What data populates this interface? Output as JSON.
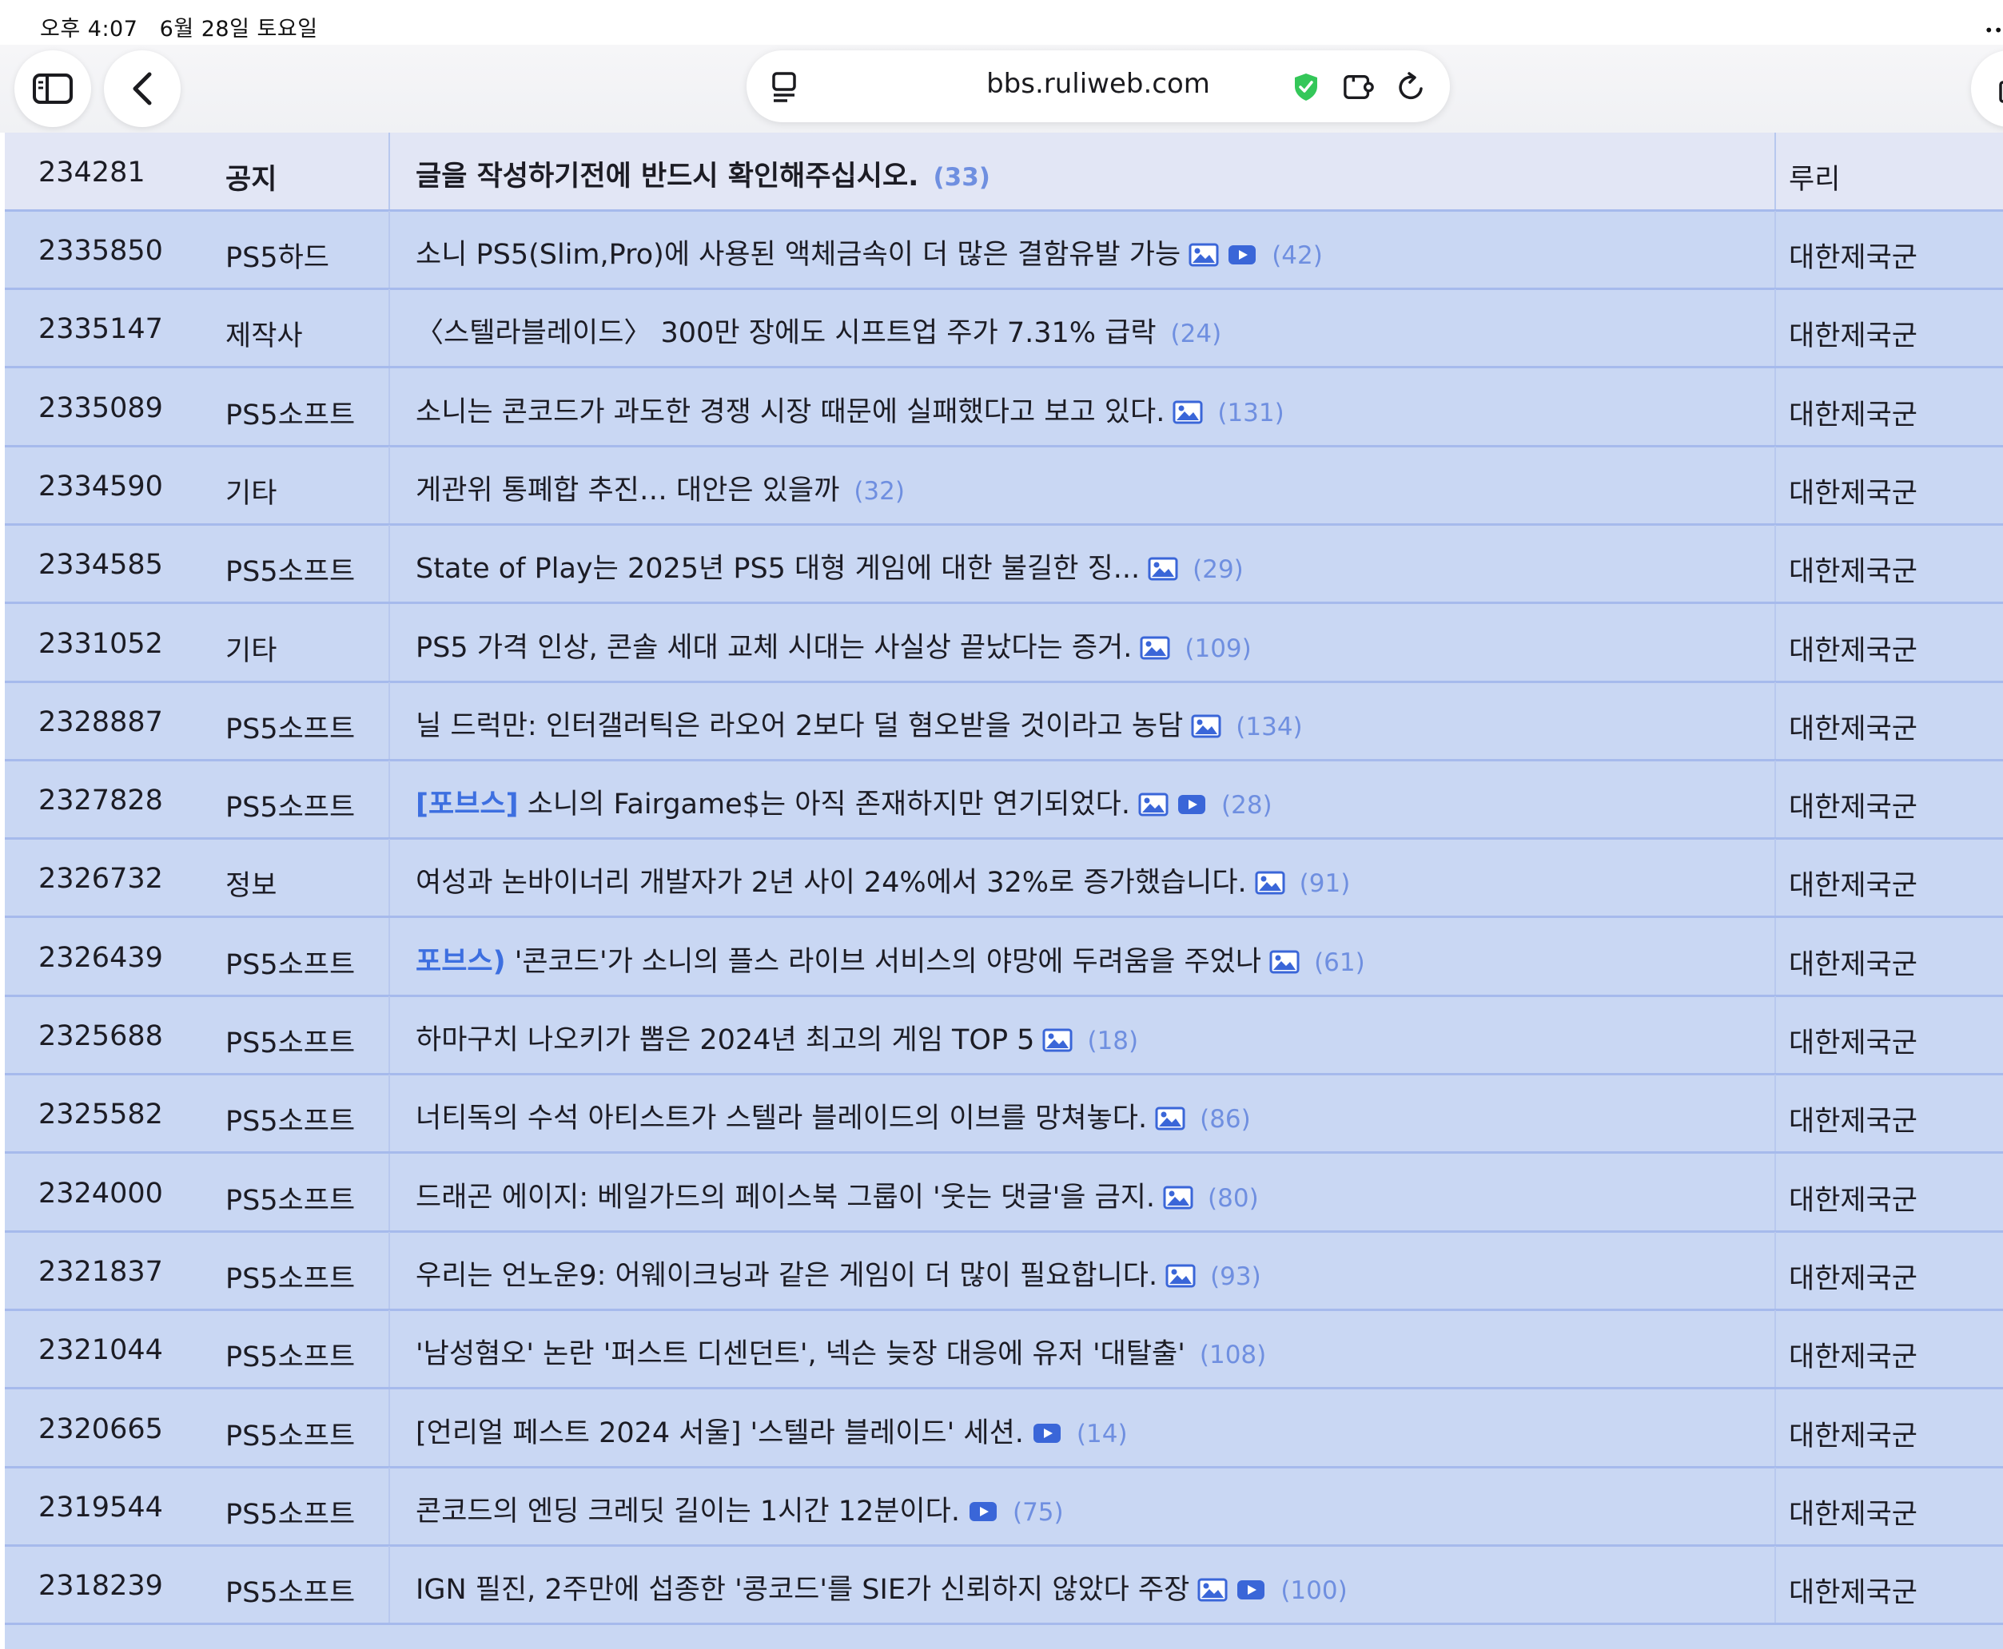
{
  "status_bar": {
    "time": "오후 4:07",
    "date": "6월 28일 토요일"
  },
  "browser": {
    "url": "bbs.ruliweb.com"
  },
  "notice": {
    "number": "234281",
    "category": "공지",
    "title": "글을 작성하기전에 반드시 확인해주십시오.",
    "comments": "(33)",
    "author": "루리"
  },
  "posts": [
    {
      "number": "2335850",
      "category": "PS5하드",
      "prefix": "",
      "title": "소니 PS5(Slim,Pro)에 사용된 액체금속이 더 많은 결함유발 가능",
      "image": true,
      "video": true,
      "comments": "(42)",
      "author": "대한제국군"
    },
    {
      "number": "2335147",
      "category": "제작사",
      "prefix": "",
      "title": "〈스텔라블레이드〉 300만 장에도 시프트업 주가 7.31% 급락",
      "image": false,
      "video": false,
      "comments": "(24)",
      "author": "대한제국군"
    },
    {
      "number": "2335089",
      "category": "PS5소프트",
      "prefix": "",
      "title": "소니는 콘코드가 과도한 경쟁 시장 때문에 실패했다고 보고 있다.",
      "image": true,
      "video": false,
      "comments": "(131)",
      "author": "대한제국군"
    },
    {
      "number": "2334590",
      "category": "기타",
      "prefix": "",
      "title": "게관위 통폐합 추진… 대안은 있을까",
      "image": false,
      "video": false,
      "comments": "(32)",
      "author": "대한제국군"
    },
    {
      "number": "2334585",
      "category": "PS5소프트",
      "prefix": "",
      "title": "State of Play는 2025년 PS5 대형 게임에 대한 불길한 징...",
      "image": true,
      "video": false,
      "comments": "(29)",
      "author": "대한제국군"
    },
    {
      "number": "2331052",
      "category": "기타",
      "prefix": "",
      "title": "PS5 가격 인상, 콘솔 세대 교체 시대는 사실상 끝났다는 증거.",
      "image": true,
      "video": false,
      "comments": "(109)",
      "author": "대한제국군"
    },
    {
      "number": "2328887",
      "category": "PS5소프트",
      "prefix": "",
      "title": "닐 드럭만: 인터갤러틱은 라오어 2보다 덜 혐오받을 것이라고 농담",
      "image": true,
      "video": false,
      "comments": "(134)",
      "author": "대한제국군"
    },
    {
      "number": "2327828",
      "category": "PS5소프트",
      "prefix": "[포브스]",
      "title": "소니의 Fairgame$는 아직 존재하지만 연기되었다.",
      "image": true,
      "video": true,
      "comments": "(28)",
      "author": "대한제국군"
    },
    {
      "number": "2326732",
      "category": "정보",
      "prefix": "",
      "title": "여성과 논바이너리 개발자가 2년 사이 24%에서 32%로 증가했습니다.",
      "image": true,
      "video": false,
      "comments": "(91)",
      "author": "대한제국군"
    },
    {
      "number": "2326439",
      "category": "PS5소프트",
      "prefix": "포브스)",
      "title": "'콘코드'가 소니의 플스 라이브 서비스의 야망에 두려움을 주었나",
      "image": true,
      "video": false,
      "comments": "(61)",
      "author": "대한제국군"
    },
    {
      "number": "2325688",
      "category": "PS5소프트",
      "prefix": "",
      "title": "하마구치 나오키가 뽑은 2024년 최고의 게임 TOP 5",
      "image": true,
      "video": false,
      "comments": "(18)",
      "author": "대한제국군"
    },
    {
      "number": "2325582",
      "category": "PS5소프트",
      "prefix": "",
      "title": "너티독의 수석 아티스트가 스텔라 블레이드의 이브를 망쳐놓다.",
      "image": true,
      "video": false,
      "comments": "(86)",
      "author": "대한제국군"
    },
    {
      "number": "2324000",
      "category": "PS5소프트",
      "prefix": "",
      "title": "드래곤 에이지: 베일가드의 페이스북 그룹이 '웃는 댓글'을 금지.",
      "image": true,
      "video": false,
      "comments": "(80)",
      "author": "대한제국군"
    },
    {
      "number": "2321837",
      "category": "PS5소프트",
      "prefix": "",
      "title": "우리는 언노운9: 어웨이크닝과 같은 게임이 더 많이 필요합니다.",
      "image": true,
      "video": false,
      "comments": "(93)",
      "author": "대한제국군"
    },
    {
      "number": "2321044",
      "category": "PS5소프트",
      "prefix": "",
      "title": "'남성혐오' 논란 '퍼스트 디센던트', 넥슨 늦장 대응에 유저 '대탈출'",
      "image": false,
      "video": false,
      "comments": "(108)",
      "author": "대한제국군"
    },
    {
      "number": "2320665",
      "category": "PS5소프트",
      "prefix": "",
      "title": "[언리얼 페스트 2024 서울] '스텔라 블레이드' 세션.",
      "image": false,
      "video": true,
      "comments": "(14)",
      "author": "대한제국군"
    },
    {
      "number": "2319544",
      "category": "PS5소프트",
      "prefix": "",
      "title": "콘코드의 엔딩 크레딧 길이는 1시간 12분이다.",
      "image": false,
      "video": true,
      "comments": "(75)",
      "author": "대한제국군"
    },
    {
      "number": "2318239",
      "category": "PS5소프트",
      "prefix": "",
      "title": "IGN 필진, 2주만에 섭종한 '콩코드'를 SIE가 신뢰하지 않았다 주장",
      "image": true,
      "video": true,
      "comments": "(100)",
      "author": "대한제국군"
    }
  ],
  "colors": {
    "board_bg": "#c9d7f3",
    "notice_bg": "#e2e6f5",
    "comment_blue": "#6f8fe0",
    "prefix_blue": "#3d6fe0",
    "icon_blue": "#3a66d8",
    "shield_green": "#34c759"
  }
}
